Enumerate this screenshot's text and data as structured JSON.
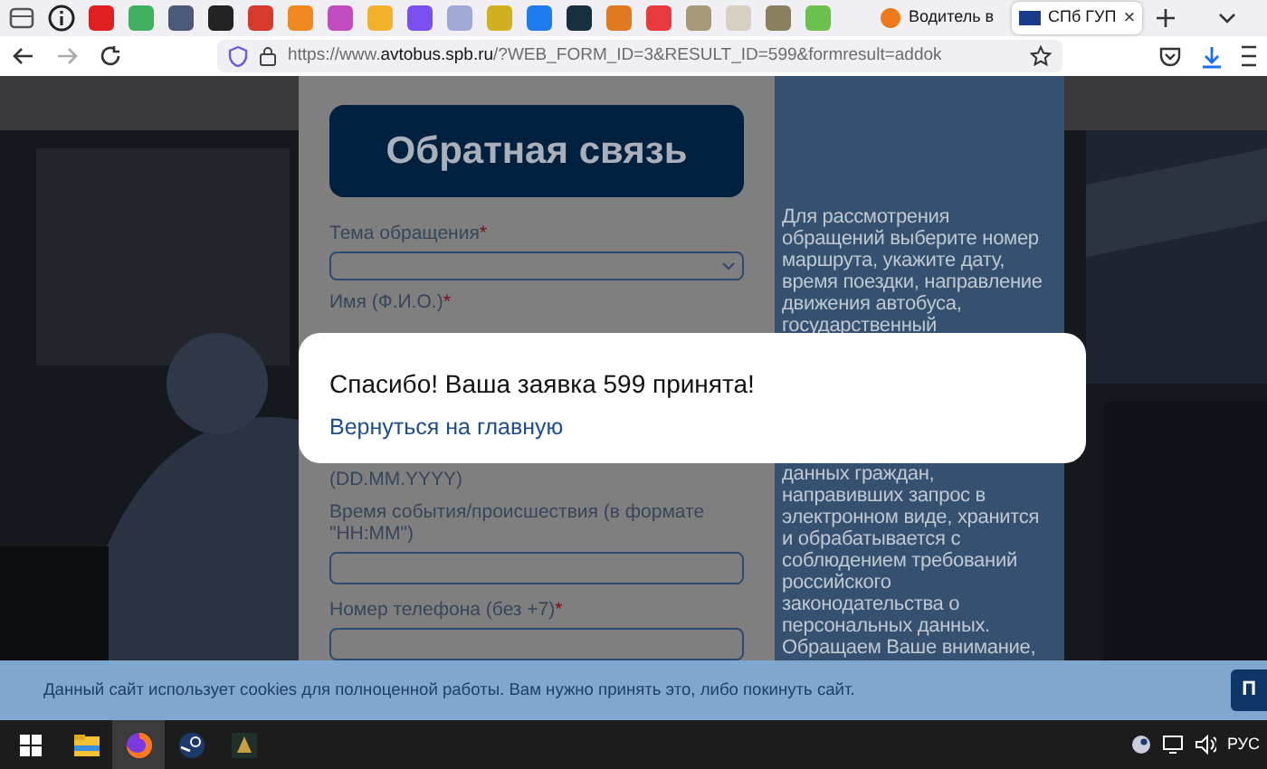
{
  "browser": {
    "tabs": [
      {
        "label": "Водитель в",
        "selected": false
      },
      {
        "label": "СПб ГУП",
        "selected": true,
        "close": "×"
      }
    ],
    "url": {
      "prefix": "https://www.",
      "domain": "avtobus.spb.ru",
      "path": "/?WEB_FORM_ID=3&RESULT_ID=599&formresult=addok"
    }
  },
  "form": {
    "title": "Обратная связь",
    "required_mark": "*",
    "items_top": [
      {
        "kind": "select",
        "label": "Тема обращения",
        "required": true
      },
      {
        "kind": "label",
        "label": "Имя (Ф.И.О.)",
        "required": true
      }
    ],
    "items_bottom": [
      {
        "kind": "label",
        "label": "(DD.MM.YYYY)",
        "required": false
      },
      {
        "kind": "input",
        "label": "Время события/происшествия (в формате \"HH:MM\")",
        "required": false
      },
      {
        "kind": "input",
        "label": "Номер телефона (без +7)",
        "required": true
      }
    ],
    "info_top": "Для рассмотрения\nобращений выберите номер\nмаршрута, укажите дату,\nвремя поездки, направление\nдвижения автобуса,\nгосударственный",
    "info_bottom": "данных граждан,\nнаправивших запрос в\nэлектронном виде, хранится\nи обрабатывается с\nсоблюдением требований\nроссийского\nзаконодательства о\nперсональных данных.\nОбращаем Ваше внимание,"
  },
  "modal": {
    "message": "Спасибо! Ваша заявка 599 принята!",
    "link": "Вернуться на главную"
  },
  "cookie_bar": {
    "text": "Данный сайт использует cookies для полноценной работы. Вам нужно принять это, либо покинуть сайт.",
    "button": "П"
  },
  "taskbar": {
    "apps": [
      {
        "kind": "folder",
        "selected": false
      },
      {
        "kind": "browser",
        "selected": true
      },
      {
        "kind": "steam",
        "selected": false
      },
      {
        "kind": "game",
        "selected": false
      }
    ],
    "language": "РУС"
  }
}
